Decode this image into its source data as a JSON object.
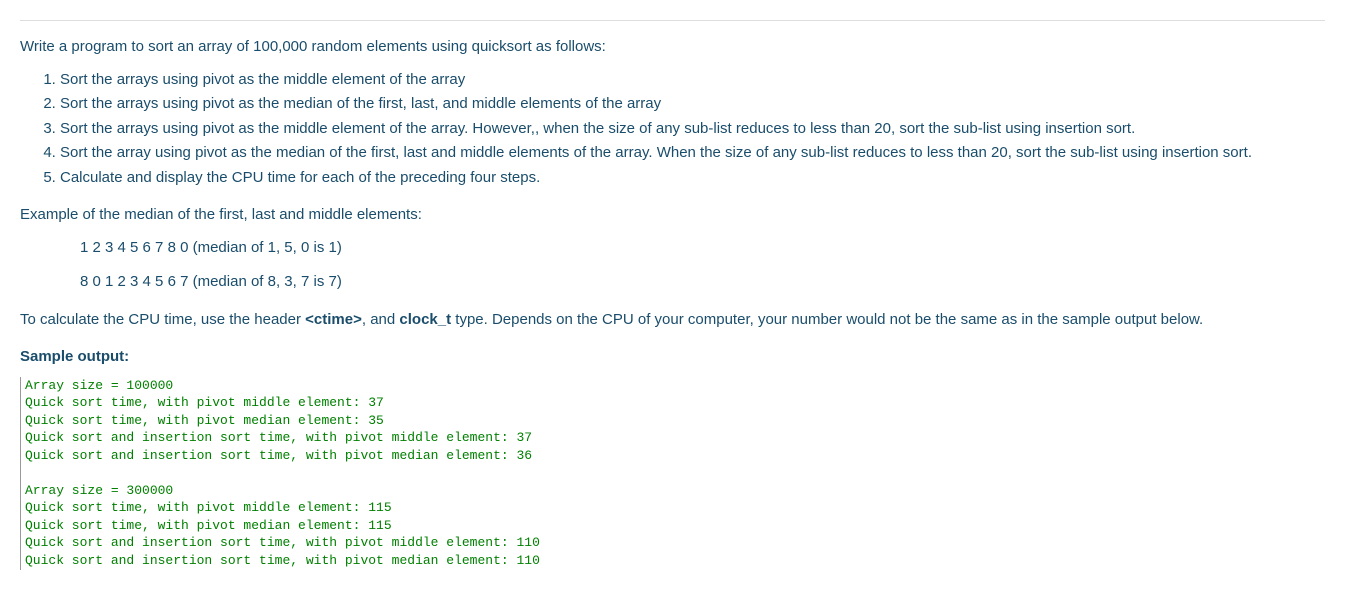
{
  "intro": "Write a program to sort an array of 100,000 random elements using quicksort as follows:",
  "steps": [
    "Sort the arrays using pivot as the middle element of the array",
    "Sort the arrays using pivot as the median of the first, last, and middle elements of the array",
    "Sort the arrays using pivot as the middle element of the array. However,, when the size of any sub-list reduces to less than 20, sort the sub-list using insertion sort.",
    "Sort the array using pivot as the median of the first, last and middle elements of the array. When the size of any sub-list reduces to less than 20, sort the sub-list using insertion sort.",
    "Calculate and display the CPU time for each of the preceding four steps."
  ],
  "example_intro": "Example of the median of the first, last and middle elements:",
  "example_lines": [
    "1 2 3 4 5 6 7 8 0 (median of 1, 5, 0 is 1)",
    "8 0 1 2 3 4 5 6 7 (median of 8, 3, 7 is 7)"
  ],
  "calc_prefix": "To calculate the CPU time, use the header ",
  "calc_header": "<ctime>",
  "calc_mid": ", and ",
  "calc_type": "clock_t",
  "calc_suffix": " type.   Depends on the CPU of your computer, your number would not be the same as in the sample output below.",
  "sample_label": "Sample output:",
  "sample_output": "Array size = 100000\nQuick sort time, with pivot middle element: 37\nQuick sort time, with pivot median element: 35\nQuick sort and insertion sort time, with pivot middle element: 37\nQuick sort and insertion sort time, with pivot median element: 36\n\nArray size = 300000\nQuick sort time, with pivot middle element: 115\nQuick sort time, with pivot median element: 115\nQuick sort and insertion sort time, with pivot middle element: 110\nQuick sort and insertion sort time, with pivot median element: 110"
}
